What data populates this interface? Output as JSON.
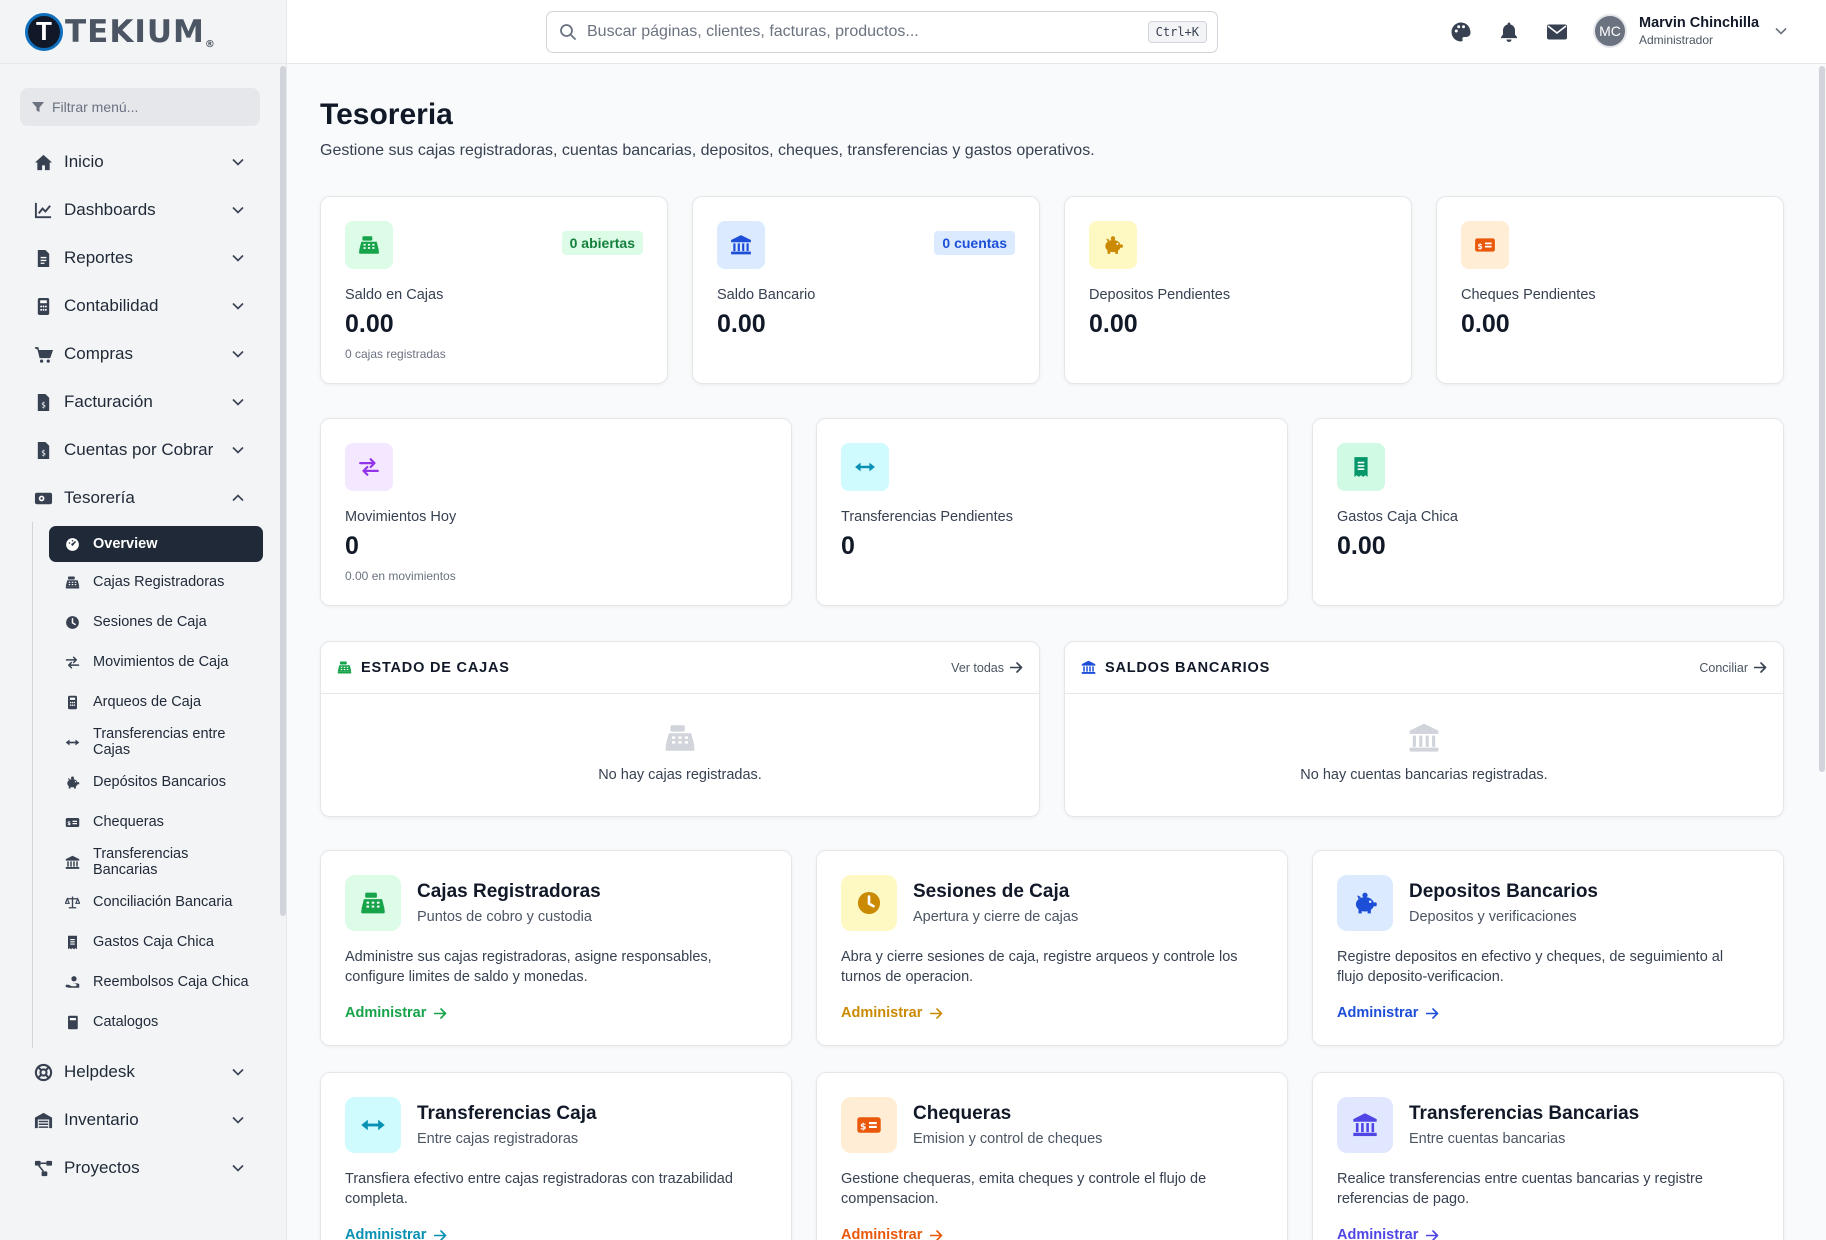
{
  "brand": {
    "name": "TEKIUM",
    "mark": "T",
    "reg": "®"
  },
  "sidebar": {
    "filter_placeholder": "Filtrar menú...",
    "items": [
      {
        "label": "Inicio",
        "icon": "home-icon"
      },
      {
        "label": "Dashboards",
        "icon": "chart-line-icon"
      },
      {
        "label": "Reportes",
        "icon": "file-icon"
      },
      {
        "label": "Contabilidad",
        "icon": "calculator-icon"
      },
      {
        "label": "Compras",
        "icon": "cart-icon"
      },
      {
        "label": "Facturación",
        "icon": "invoice-icon"
      },
      {
        "label": "Cuentas por Cobrar",
        "icon": "invoice-dollar-icon"
      },
      {
        "label": "Tesorería",
        "icon": "money-bill-icon"
      },
      {
        "label": "Helpdesk",
        "icon": "lifebuoy-icon"
      },
      {
        "label": "Inventario",
        "icon": "warehouse-icon"
      },
      {
        "label": "Proyectos",
        "icon": "diagram-icon"
      }
    ],
    "tesoreria_sub": [
      {
        "label": "Overview",
        "icon": "gauge-icon"
      },
      {
        "label": "Cajas Registradoras",
        "icon": "cash-register-icon"
      },
      {
        "label": "Sesiones de Caja",
        "icon": "clock-icon"
      },
      {
        "label": "Movimientos de Caja",
        "icon": "exchange-icon"
      },
      {
        "label": "Arqueos de Caja",
        "icon": "calculator-icon"
      },
      {
        "label": "Transferencias entre Cajas",
        "icon": "arrows-h-icon"
      },
      {
        "label": "Depósitos Bancarios",
        "icon": "piggy-bank-icon"
      },
      {
        "label": "Chequeras",
        "icon": "money-check-icon"
      },
      {
        "label": "Transferencias Bancarias",
        "icon": "bank-icon"
      },
      {
        "label": "Conciliación Bancaria",
        "icon": "scale-icon"
      },
      {
        "label": "Gastos Caja Chica",
        "icon": "receipt-icon"
      },
      {
        "label": "Reembolsos Caja Chica",
        "icon": "hand-money-icon"
      },
      {
        "label": "Catalogos",
        "icon": "book-icon"
      }
    ]
  },
  "header": {
    "search_placeholder": "Buscar páginas, clientes, facturas, productos...",
    "shortcut": "Ctrl+K",
    "user_name": "Marvin Chinchilla",
    "user_role": "Administrador",
    "user_initials": "MC"
  },
  "page": {
    "title": "Tesoreria",
    "subtitle": "Gestione sus cajas registradoras, cuentas bancarias, depositos, cheques, transferencias y gastos operativos."
  },
  "stats_row1": [
    {
      "label": "Saldo en Cajas",
      "value": "0.00",
      "note": "0 cajas registradas",
      "badge": "0 abiertas",
      "icon": "cash-register-icon",
      "color": "#16a34a",
      "bg": "#dcfce7",
      "badge_bg": "#dcfce7",
      "badge_color": "#15803d"
    },
    {
      "label": "Saldo Bancario",
      "value": "0.00",
      "note": "",
      "badge": "0 cuentas",
      "icon": "bank-icon",
      "color": "#1d4ed8",
      "bg": "#dbeafe",
      "badge_bg": "#dbeafe",
      "badge_color": "#1d4ed8"
    },
    {
      "label": "Depositos Pendientes",
      "value": "0.00",
      "note": "",
      "badge": "",
      "icon": "piggy-bank-icon",
      "color": "#ca8a04",
      "bg": "#fef9c3"
    },
    {
      "label": "Cheques Pendientes",
      "value": "0.00",
      "note": "",
      "badge": "",
      "icon": "money-check-icon",
      "color": "#ea580c",
      "bg": "#ffedd5"
    }
  ],
  "stats_row2": [
    {
      "label": "Movimientos Hoy",
      "value": "0",
      "note": "0.00 en movimientos",
      "icon": "exchange-icon",
      "color": "#9333ea",
      "bg": "#f3e8ff"
    },
    {
      "label": "Transferencias Pendientes",
      "value": "0",
      "note": "",
      "icon": "arrows-h-icon",
      "color": "#0891b2",
      "bg": "#cffafe"
    },
    {
      "label": "Gastos Caja Chica",
      "value": "0.00",
      "note": "",
      "icon": "receipt-icon",
      "color": "#059669",
      "bg": "#d1fae5"
    }
  ],
  "panels": [
    {
      "title": "ESTADO DE CAJAS",
      "link": "Ver todas",
      "empty": "No hay cajas registradas.",
      "icon": "cash-register-icon",
      "color": "#16a34a"
    },
    {
      "title": "SALDOS BANCARIOS",
      "link": "Conciliar",
      "empty": "No hay cuentas bancarias registradas.",
      "icon": "bank-icon",
      "color": "#1d4ed8"
    }
  ],
  "modules": [
    {
      "title": "Cajas Registradoras",
      "sub": "Puntos de cobro y custodia",
      "desc": "Administre sus cajas registradoras, asigne responsables, configure limites de saldo y monedas.",
      "link": "Administrar",
      "icon": "cash-register-icon",
      "color": "#16a34a",
      "bg": "#dcfce7"
    },
    {
      "title": "Sesiones de Caja",
      "sub": "Apertura y cierre de cajas",
      "desc": "Abra y cierre sesiones de caja, registre arqueos y controle los turnos de operacion.",
      "link": "Administrar",
      "icon": "clock-icon",
      "color": "#ca8a04",
      "bg": "#fef9c3"
    },
    {
      "title": "Depositos Bancarios",
      "sub": "Depositos y verificaciones",
      "desc": "Registre depositos en efectivo y cheques, de seguimiento al flujo deposito-verificacion.",
      "link": "Administrar",
      "icon": "piggy-bank-icon",
      "color": "#1d4ed8",
      "bg": "#dbeafe"
    },
    {
      "title": "Transferencias Caja",
      "sub": "Entre cajas registradoras",
      "desc": "Transfiera efectivo entre cajas registradoras con trazabilidad completa.",
      "link": "Administrar",
      "icon": "arrows-h-icon",
      "color": "#0891b2",
      "bg": "#cffafe"
    },
    {
      "title": "Chequeras",
      "sub": "Emision y control de cheques",
      "desc": "Gestione chequeras, emita cheques y controle el flujo de compensacion.",
      "link": "Administrar",
      "icon": "money-check-icon",
      "color": "#ea580c",
      "bg": "#ffedd5"
    },
    {
      "title": "Transferencias Bancarias",
      "sub": "Entre cuentas bancarias",
      "desc": "Realice transferencias entre cuentas bancarias y registre referencias de pago.",
      "link": "Administrar",
      "icon": "bank-icon",
      "color": "#4f46e5",
      "bg": "#e0e7ff"
    }
  ]
}
